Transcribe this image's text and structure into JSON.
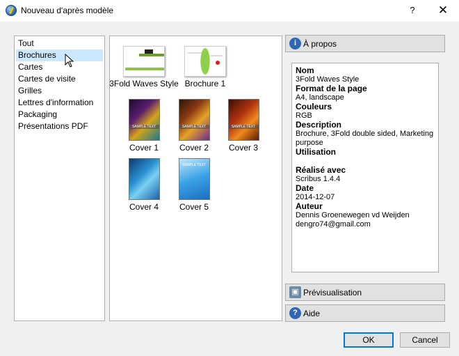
{
  "window": {
    "title": "Nouveau d'après modèle",
    "help": "?",
    "close": "✕"
  },
  "categories": [
    "Tout",
    "Brochures",
    "Cartes",
    "Cartes de visite",
    "Grilles",
    "Lettres d'information",
    "Packaging",
    "Présentations PDF"
  ],
  "selected_category": "Brochures",
  "templates": [
    {
      "label": "3Fold Waves Style",
      "kind": "brochure"
    },
    {
      "label": "Brochure 1",
      "kind": "brochure"
    },
    {
      "label": "Cover 1",
      "kind": "cover",
      "cover_text": "SAMPLE TEXT"
    },
    {
      "label": "Cover 2",
      "kind": "cover",
      "cover_text": "SAMPLE TEXT"
    },
    {
      "label": "Cover 3",
      "kind": "cover",
      "cover_text": "SAMPLE TEXT"
    },
    {
      "label": "Cover 4",
      "kind": "cover",
      "cover_text": ""
    },
    {
      "label": "Cover 5",
      "kind": "cover",
      "cover_text": "SAMPLE TEXT"
    }
  ],
  "about_button": "À propos",
  "preview_button": "Prévisualisation",
  "help_button": "Aide",
  "info": [
    {
      "key": "Nom",
      "value": "3Fold Waves Style"
    },
    {
      "key": "Format de la page",
      "value": "A4, landscape"
    },
    {
      "key": "Couleurs",
      "value": "RGB"
    },
    {
      "key": "Description",
      "value": "Brochure, 3Fold double sided, Marketing purpose"
    },
    {
      "key": "Utilisation",
      "value": ""
    },
    {
      "key": "Réalisé avec",
      "value": "Scribus 1.4.4"
    },
    {
      "key": "Date",
      "value": "2014-12-07"
    },
    {
      "key": "Auteur",
      "value": "Dennis Groenewegen vd Weijden\ndengro74@gmail.com"
    }
  ],
  "ok_button": "OK",
  "cancel_button": "Cancel"
}
